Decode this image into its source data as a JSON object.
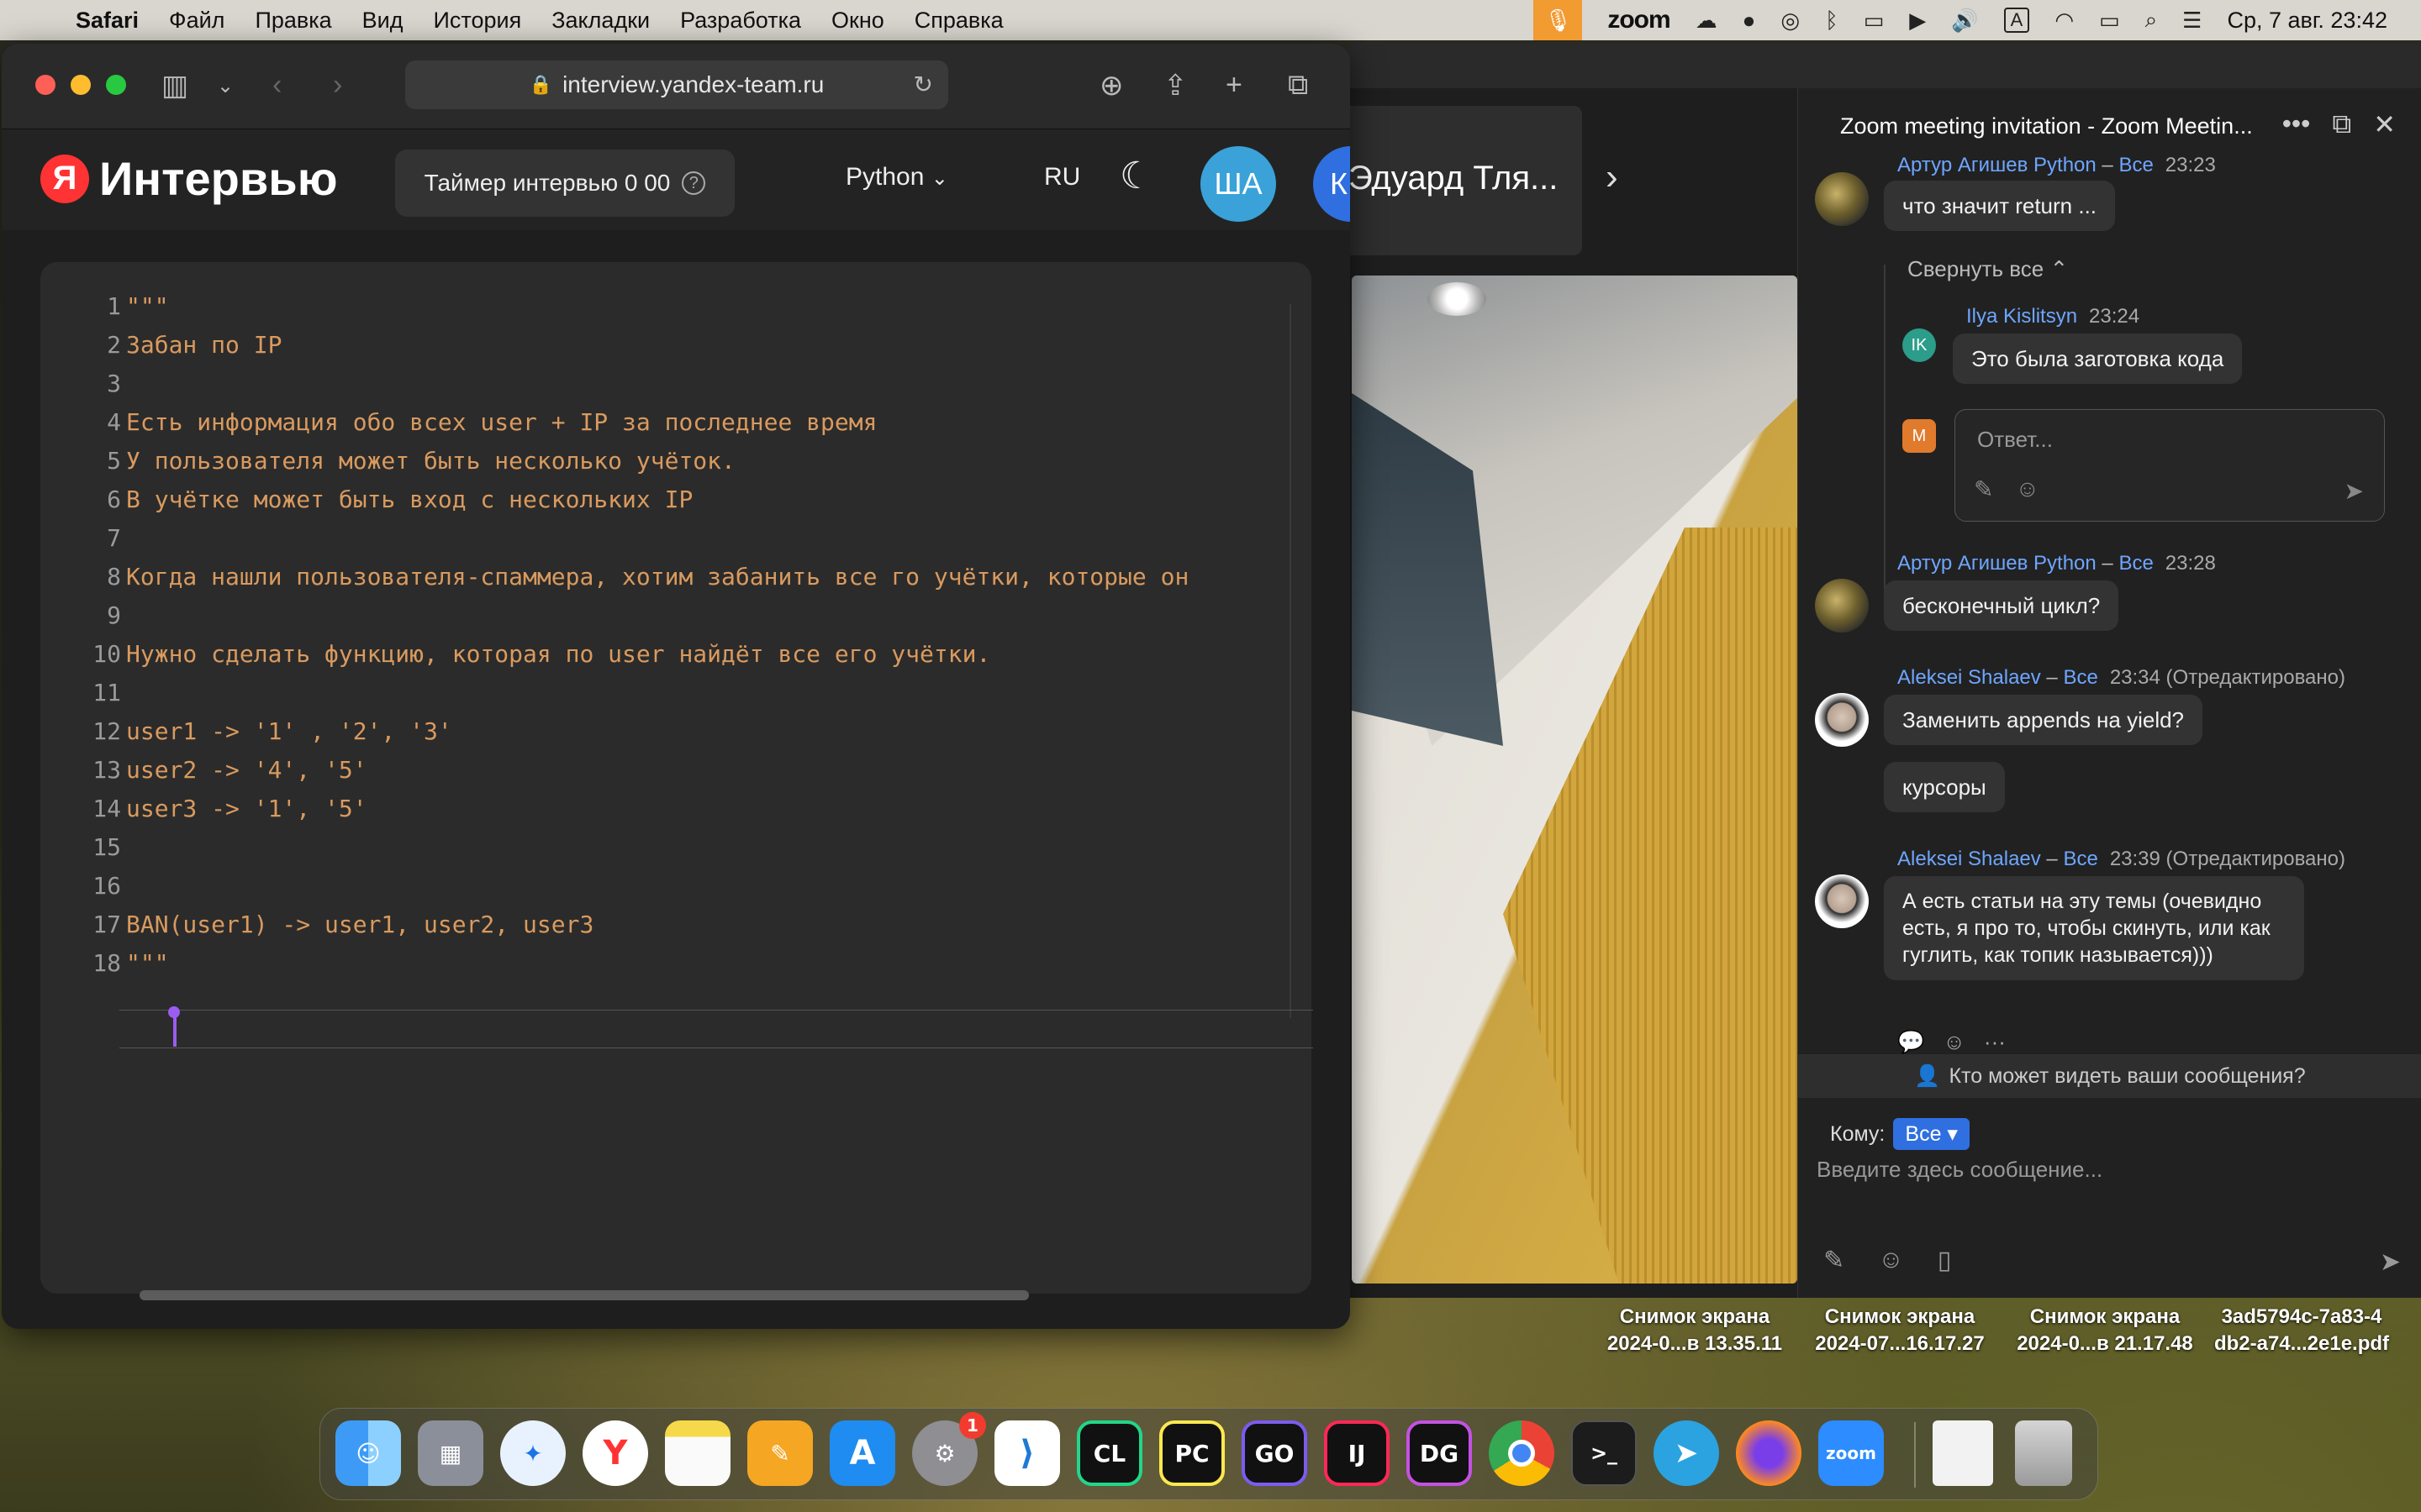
{
  "menubar": {
    "app": "Safari",
    "items": [
      "Файл",
      "Правка",
      "Вид",
      "История",
      "Закладки",
      "Разработка",
      "Окно",
      "Справка"
    ],
    "zoom_label": "zoom",
    "input_source": "A",
    "clock": "Ср, 7 авг.  23:42"
  },
  "browser": {
    "url": "interview.yandex-team.ru"
  },
  "app": {
    "logo_letter": "Я",
    "logo_name": "Интервью",
    "timer_label": "Таймер интервью 0 00",
    "language": "Python",
    "locale": "RU",
    "avatar1": "ША",
    "avatar2": "К"
  },
  "editor": {
    "lines": [
      {
        "n": "1",
        "t": "\"\"\""
      },
      {
        "n": "2",
        "t": "Забан по IP"
      },
      {
        "n": "3",
        "t": ""
      },
      {
        "n": "4",
        "t": "Есть информация обо всех user + IP за последнее время"
      },
      {
        "n": "5",
        "t": "У пользователя может быть несколько учёток."
      },
      {
        "n": "6",
        "t": "В учётке может быть вход с нескольких IP"
      },
      {
        "n": "7",
        "t": ""
      },
      {
        "n": "8",
        "t": "Когда нашли пользователя-спаммера, хотим забанить все го учётки, которые он"
      },
      {
        "n": "9",
        "t": ""
      },
      {
        "n": "10",
        "t": "Нужно сделать функцию, которая по user найдёт все его учётки."
      },
      {
        "n": "11",
        "t": ""
      },
      {
        "n": "12",
        "t": "user1 -> '1' , '2', '3'"
      },
      {
        "n": "13",
        "t": "user2 -> '4', '5'"
      },
      {
        "n": "14",
        "t": "user3 -> '1', '5'"
      },
      {
        "n": "15",
        "t": ""
      },
      {
        "n": "16",
        "t": ""
      },
      {
        "n": "17",
        "t": "BAN(user1) -> user1, user2, user3"
      },
      {
        "n": "18",
        "t": "\"\"\""
      }
    ]
  },
  "zoom": {
    "participant_name": "Эдуард Тля...",
    "chat_title": "Zoom meeting invitation - Zoom Meetin...",
    "messages": [
      {
        "sender": "Артур Агишев Python",
        "to": "Все",
        "time": "23:23",
        "text": "что значит return ..."
      },
      {
        "sender": "Ilya Kislitsyn",
        "to": "",
        "time": "23:24",
        "text": "Это была заготовка кода",
        "initials": "IK"
      },
      {
        "sender": "Артур Агишев Python",
        "to": "Все",
        "time": "23:28",
        "text": "бесконечный цикл?"
      },
      {
        "sender": "Aleksei Shalaev",
        "to": "Все",
        "time": "23:34 (Отредактировано)",
        "text": "Заменить appends на yield?",
        "text2": "курсоры"
      },
      {
        "sender": "Aleksei Shalaev",
        "to": "Все",
        "time": "23:39 (Отредактировано)",
        "text": "А есть статьи на эту темы (очевидно есть, я про то, чтобы скинуть, или как гуглить, как топик называется)))"
      }
    ],
    "collapse_all": "Свернуть все",
    "reply_avatar": "M",
    "reply_placeholder": "Ответ...",
    "who_can_see": "Кто может видеть ваши сообщения?",
    "to_label": "Кому:",
    "to_value": "Все",
    "input_placeholder": "Введите здесь сообщение..."
  },
  "desktop_files": [
    {
      "line1": "Снимок экрана",
      "line2": "2024-0...в 13.35.11"
    },
    {
      "line1": "Снимок экрана",
      "line2": "2024-07...16.17.27"
    },
    {
      "line1": "Снимок экрана",
      "line2": "2024-0...в 21.17.48"
    },
    {
      "line1": "3ad5794c-7a83-4",
      "line2": "db2-a74...2e1e.pdf"
    }
  ],
  "dock": {
    "settings_badge": "1",
    "labels": {
      "clion": "CL",
      "pycharm": "PC",
      "goland": "GO",
      "intellij": "IJ",
      "datagrip": "DG",
      "terminal": ">_",
      "zoom": "zoom"
    }
  }
}
